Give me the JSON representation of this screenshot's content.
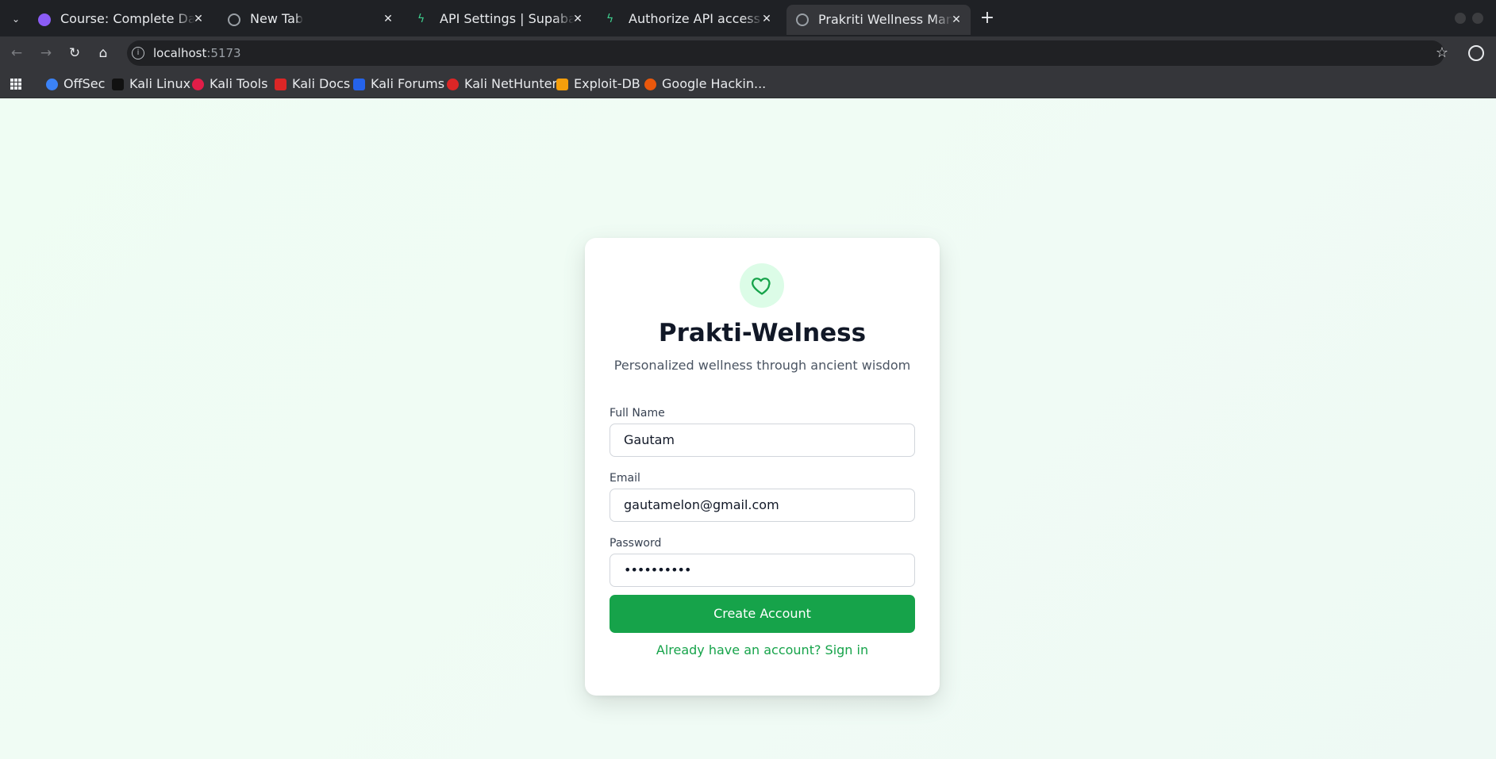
{
  "browser": {
    "tabs": [
      {
        "title": "Course: Complete Data S",
        "fav_color": "#8b5cf6",
        "active": false
      },
      {
        "title": "New Tab",
        "fav_color": "#9aa0a6",
        "active": false
      },
      {
        "title": "API Settings | Supabase",
        "fav_color": "#3ecf8e",
        "active": false
      },
      {
        "title": "Authorize API access | Su",
        "fav_color": "#3ecf8e",
        "active": false
      },
      {
        "title": "Prakriti Wellness Manage",
        "fav_color": "#9aa0a6",
        "active": true
      }
    ],
    "new_tab_label": "+",
    "address": {
      "host": "localhost",
      "port": ":5173"
    },
    "bookmarks": [
      {
        "label": "OffSec",
        "color": "#3b82f6"
      },
      {
        "label": "Kali Linux",
        "color": "#111111"
      },
      {
        "label": "Kali Tools",
        "color": "#e11d48"
      },
      {
        "label": "Kali Docs",
        "color": "#dc2626"
      },
      {
        "label": "Kali Forums",
        "color": "#2563eb"
      },
      {
        "label": "Kali NetHunter",
        "color": "#dc2626"
      },
      {
        "label": "Exploit-DB",
        "color": "#f59e0b"
      },
      {
        "label": "Google Hackin...",
        "color": "#ea580c"
      }
    ]
  },
  "app": {
    "brand": "Prakti-Welness",
    "tagline": "Personalized wellness through ancient wisdom",
    "accent_color": "#16a34a",
    "form": {
      "full_name_label": "Full Name",
      "full_name_value": "Gautam",
      "email_label": "Email",
      "email_value": "gautamelon@gmail.com",
      "password_label": "Password",
      "password_value": "••••••••••",
      "submit_label": "Create Account",
      "signin_link": "Already have an account? Sign in"
    }
  }
}
